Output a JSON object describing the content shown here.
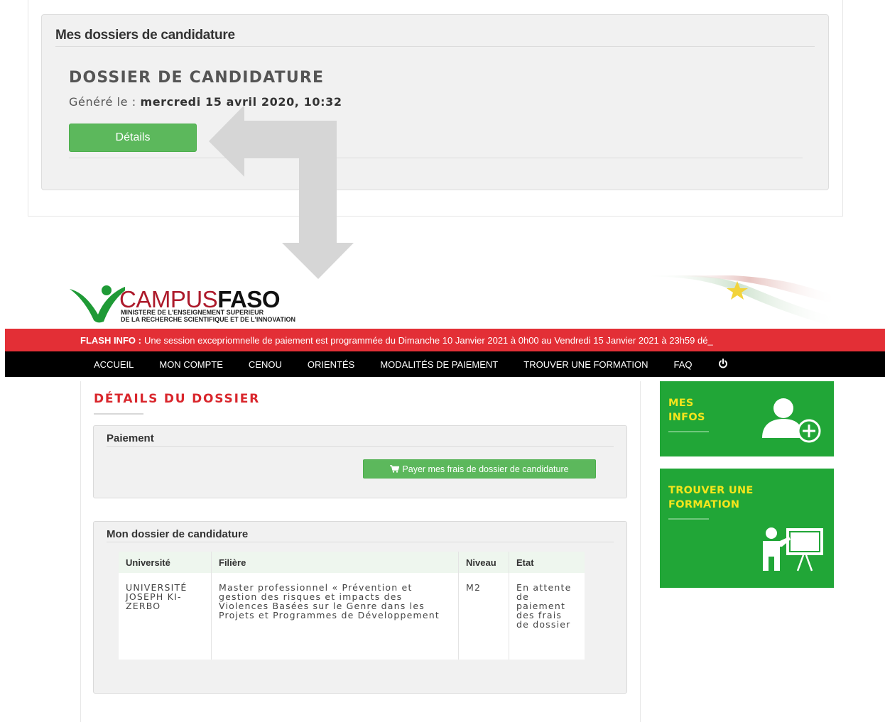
{
  "top_panel": {
    "title": "Mes dossiers de candidature",
    "dossier_heading": "DOSSIER DE CANDIDATURE",
    "generated_label": "Généré le : ",
    "generated_date": "mercredi 15 avril 2020, 10:32",
    "details_button": "Détails"
  },
  "header": {
    "brand_campus": "CAMPUS",
    "brand_faso": "FASO",
    "ministry_line1": "MINISTERE DE L'ENSEIGNEMENT SUPERIEUR",
    "ministry_line2": "DE LA RECHERCHE SCIENTIFIQUE ET DE L'INNOVATION"
  },
  "flash": {
    "label": "FLASH INFO :",
    "text": "Une session excepriomnelle de paiement est programmée du Dimanche 10 Janvier 2021 à 0h00 au Vendredi 15 Janvier 2021 à 23h59 dé_"
  },
  "nav": {
    "items": [
      "ACCUEIL",
      "MON COMPTE",
      "CENOU",
      "ORIENTÉS",
      "MODALITÉS DE PAIEMENT",
      "TROUVER UNE FORMATION",
      "FAQ"
    ]
  },
  "details": {
    "title": "DÉTAILS DU DOSSIER",
    "payment_panel_title": "Paiement",
    "pay_button": "Payer mes frais de dossier de candidature",
    "application_panel_title": "Mon dossier de candidature",
    "table": {
      "headers": [
        "Université",
        "Filière",
        "Niveau",
        "Etat"
      ],
      "rows": [
        [
          "UNIVERSITÉ JOSEPH KI-ZERBO",
          "Master professionnel « Prévention et gestion des risques et impacts des Violences Basées sur le Genre dans les Projets et Programmes de Développement",
          "M2",
          "En attente de paiement des frais de dossier"
        ]
      ]
    }
  },
  "sidebar": {
    "tile_infos_line1": "MES",
    "tile_infos_line2": "INFOS",
    "tile_formation_line1": "TROUVER UNE",
    "tile_formation_line2": "FORMATION"
  },
  "colors": {
    "accent_red": "#e32f36",
    "button_green": "#5cb85c",
    "tile_green": "#21a637",
    "tile_title_yellow": "#f4e51c"
  },
  "icons": [
    "cart-icon",
    "power-icon",
    "user-add-icon",
    "teacher-board-icon",
    "campusfaso-logo",
    "flag-decoration"
  ]
}
